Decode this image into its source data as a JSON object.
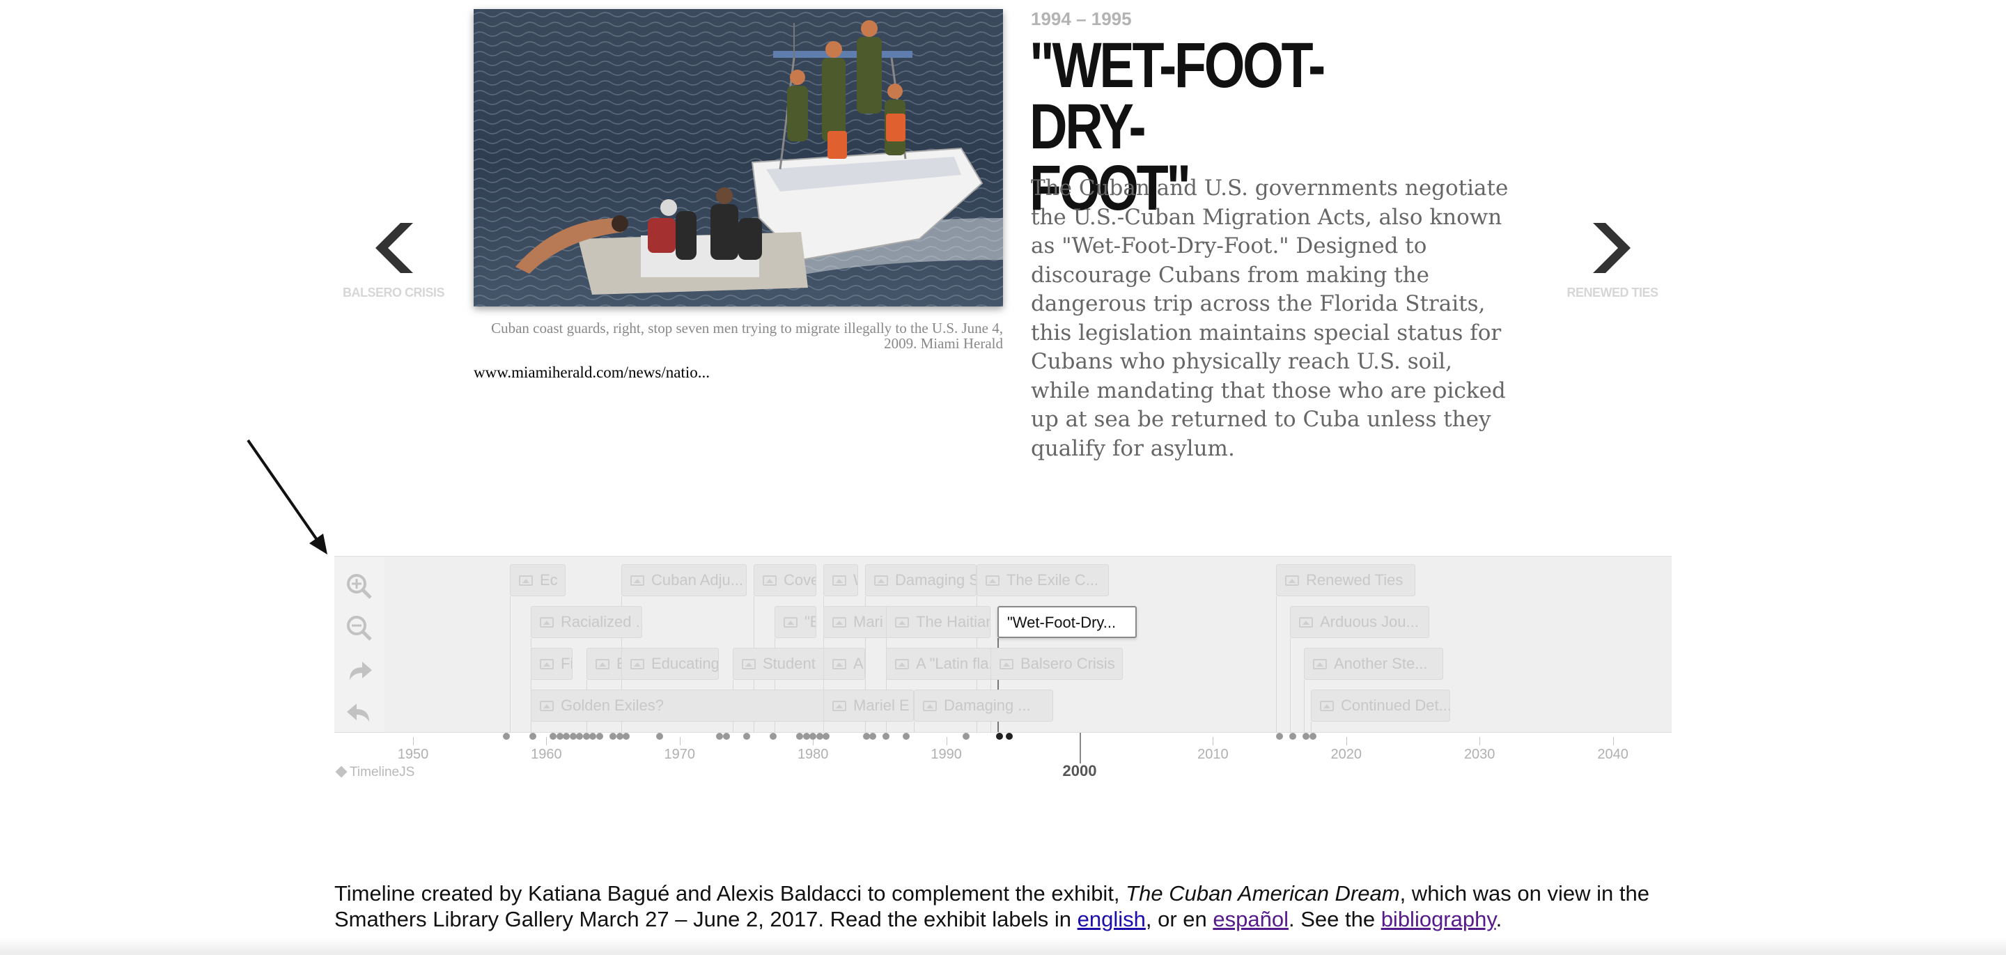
{
  "slide": {
    "date": "1994 – 1995",
    "title_line1": "\"WET-FOOT-DRY-",
    "title_line2": "FOOT\"",
    "text": "The Cuban and U.S. governments negotiate the U.S.-Cuban Migration Acts, also known as \"Wet-Foot-Dry-Foot.\" Designed to discourage Cubans from making the dangerous trip across the Florida Straits, this legislation maintains special status for Cubans who physically reach U.S. soil, while mandating that those who are picked up at sea be returned to Cuba unless they qualify for asylum.",
    "caption": "Cuban coast guards, right, stop seven men trying to migrate illegally to the U.S. June 4, 2009. Miami Herald",
    "credit_link": "www.miamiherald.com/news/natio...",
    "image_icon": "photo-boat-migrants"
  },
  "nav": {
    "prev_label": "BALSERO CRISIS",
    "next_label": "RENEWED TIES",
    "prev_icon": "chevron-left-icon",
    "next_icon": "chevron-right-icon"
  },
  "timenav": {
    "controls": [
      "zoom-in-icon",
      "zoom-out-icon",
      "redo-icon",
      "undo-icon"
    ],
    "markers": [
      {
        "label": "Ec",
        "row": 0
      },
      {
        "label": "Cuban Adju...",
        "row": 0
      },
      {
        "label": "Cove",
        "row": 0
      },
      {
        "label": "W",
        "row": 0
      },
      {
        "label": "Damaging S",
        "row": 0
      },
      {
        "label": "The Exile C...",
        "row": 0
      },
      {
        "label": "Renewed Ties",
        "row": 0
      },
      {
        "label": "Racialized ...",
        "row": 1
      },
      {
        "label": "\"E",
        "row": 1
      },
      {
        "label": "Mari",
        "row": 1
      },
      {
        "label": "The Haitian",
        "row": 1
      },
      {
        "label": "\"Wet-Foot-Dry...",
        "row": 1,
        "active": true
      },
      {
        "label": "Arduous Jou...",
        "row": 1
      },
      {
        "label": "Fi",
        "row": 2
      },
      {
        "label": "E",
        "row": 2
      },
      {
        "label": "Educating",
        "row": 2
      },
      {
        "label": "Student",
        "row": 2
      },
      {
        "label": "A D",
        "row": 2
      },
      {
        "label": "A \"Latin fla...",
        "row": 2
      },
      {
        "label": "Balsero Crisis",
        "row": 2
      },
      {
        "label": "Another Ste...",
        "row": 2
      },
      {
        "label": "Golden Exiles?",
        "row": 3
      },
      {
        "label": "Mariel E",
        "row": 3
      },
      {
        "label": "Damaging ...",
        "row": 3
      },
      {
        "label": "Continued Det...",
        "row": 3
      }
    ],
    "axis_years": [
      "1950",
      "1960",
      "1970",
      "1980",
      "1990",
      "2000",
      "2010",
      "2020",
      "2030",
      "2040"
    ],
    "highlighted_year": "2000",
    "brand": "TimelineJS"
  },
  "footer": {
    "text1": "Timeline created by Katiana Bagué and Alexis Baldacci to complement the exhibit, ",
    "exhibit": "The Cuban American Dream",
    "text2": ", which was on view in the Smathers Library Gallery March 27 – June 2, 2017. Read the exhibit labels in ",
    "link_english": "english",
    "text3": ", or en ",
    "link_spanish": "español",
    "text4": ". See the ",
    "link_bibliography": "bibliography",
    "text5": "."
  },
  "colors": {
    "title": "#111111",
    "body_text": "#666666",
    "date": "#b3b3b3",
    "link": "#1a0dab",
    "visited_link": "#551a8b",
    "timenav_bg": "#efefef"
  }
}
